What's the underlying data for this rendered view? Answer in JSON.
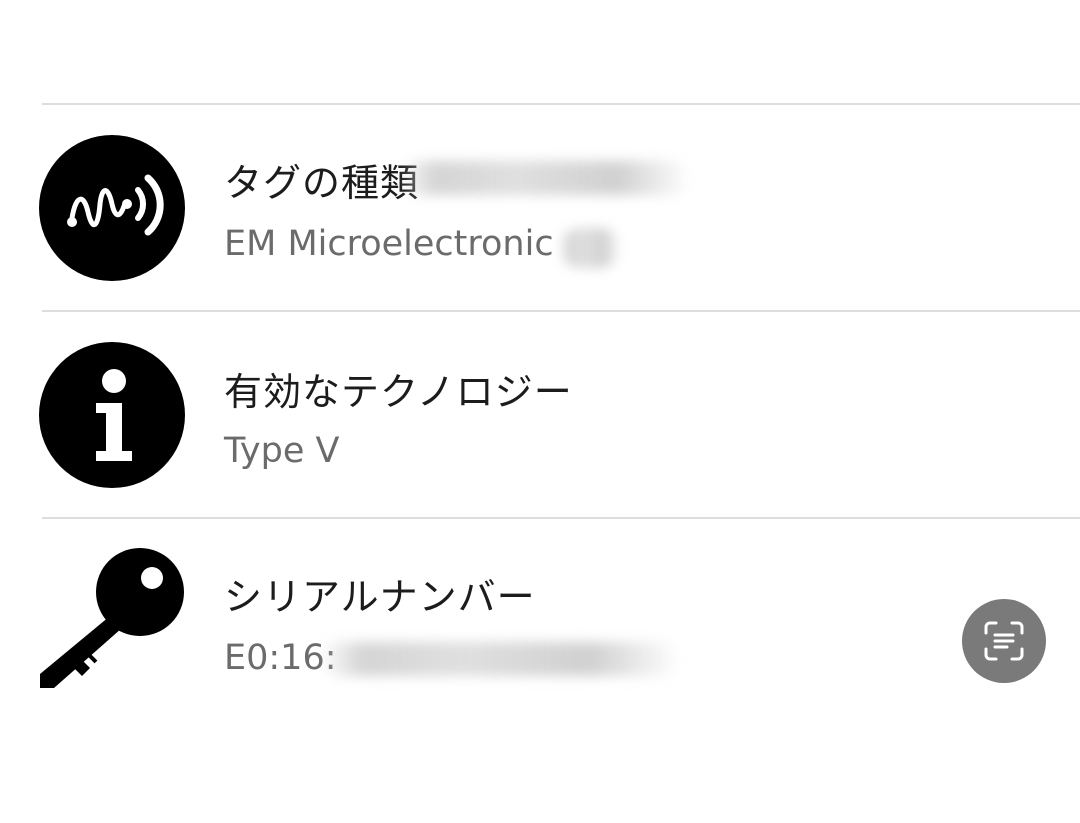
{
  "rows": [
    {
      "title": "タグの種類",
      "value": "EM Microelectronic",
      "icon": "nfc-wave-icon"
    },
    {
      "title": "有効なテクノロジー",
      "value": "Type V",
      "icon": "info-icon"
    },
    {
      "title": "シリアルナンバー",
      "value": "E0:16:",
      "icon": "key-icon"
    }
  ],
  "floating_button": {
    "icon": "live-text-scan-icon"
  },
  "colors": {
    "title_text": "#1c1c1c",
    "value_text": "#6b6b6b",
    "divider": "#dddddd",
    "icon": "#000000",
    "floating_button_bg": "#7a7a7a"
  }
}
